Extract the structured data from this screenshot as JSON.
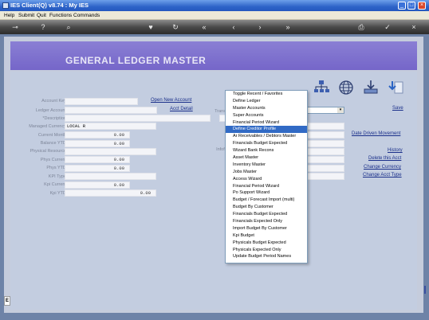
{
  "window": {
    "title": "IES Client(Q) v8.74 : My IES"
  },
  "menu": {
    "items": [
      "Help",
      "Submit",
      "Quit",
      "Functions",
      "Commands"
    ]
  },
  "toolbar": {
    "icons": [
      "key-icon",
      "help-icon",
      "search-icon",
      "heart-icon",
      "refresh-icon",
      "rewind-icon",
      "back-icon",
      "forward-icon",
      "fast-forward-icon",
      "print-icon",
      "check-icon",
      "close-icon"
    ]
  },
  "page": {
    "title": "GENERAL LEDGER MASTER"
  },
  "form": {
    "labels": {
      "account_key": "Account Key",
      "ledger_account": "Ledger Account",
      "description": "*Description",
      "managed_currency": "Managed Currency",
      "current_month": "Current Month",
      "balance_ytd": "Balance YTD",
      "physical_resource": "Physical Resource",
      "phys_current": "Phys Current",
      "phys_ytd": "Phys YTD",
      "kpi_type": "KPI Type",
      "kpi_current": "Kpi Current",
      "kpi_ytd": "Kpi YTD"
    },
    "values": {
      "managed_currency": "LOCAL R",
      "current_month": "0.00",
      "balance_ytd": "0.00",
      "phys_current": "0.00",
      "phys_ytd": "0.00",
      "kpi_current": "0.00",
      "kpi_ytd": "0.00"
    },
    "mid_labels": {
      "trans": "Trans",
      "infofield": "Infofi"
    },
    "links": {
      "open_new_account": "Open New Account",
      "acct_detail": "Acct Detail",
      "save": "Save",
      "date_driven_movement": "Date Driven Movement",
      "history": "History",
      "delete_this_acct": "Delete this Acct",
      "change_currency": "Change Currency",
      "change_acct_type": "Change Acct Type"
    }
  },
  "dropdown": {
    "selected_index": 5,
    "items": [
      "Toggle Recent / Favorites",
      "Define Ledger",
      "Master Accounts",
      "Super Accounts",
      "Financial Period Wizard",
      "Define Creditor Profile",
      "Ar Receivables / Debtors Master",
      "Financials Budget  Expected",
      "Wizard Bank Recons",
      "Asset Master",
      "Inventory Master",
      "Jobs Master",
      "Access Wizard",
      "Financial Period Wizard",
      "Po Support Wizard",
      "Budget / Forecast Import (multi)",
      "Budget By Customer",
      "Financials Budget  Expected",
      "Financials Expected Only",
      "Import Budget By Customer",
      "Kpi Budget",
      "Physicals Budget  Expected",
      "Physicals Expected Only",
      "Update Budget Period Names"
    ]
  },
  "side": {
    "label": "E"
  }
}
